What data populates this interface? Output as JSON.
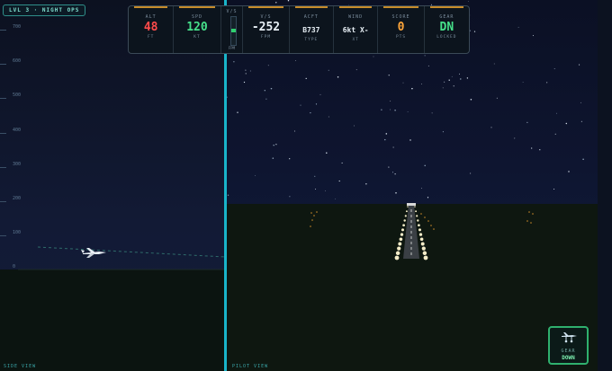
{
  "level_badge": "LVL 3 · NIGHT OPS",
  "side_view": {
    "label": "SIDE VIEW",
    "altitude_ticks": [
      "700",
      "600",
      "500",
      "400",
      "300",
      "200",
      "100",
      "0"
    ],
    "aircraft_icon": "jet-silhouette"
  },
  "pilot_view": {
    "label": "PILOT VIEW"
  },
  "hud": {
    "alt": {
      "label": "ALT",
      "value": "48",
      "unit": "FT"
    },
    "spd": {
      "label": "SPD",
      "value": "120",
      "unit": "KT"
    },
    "vs_meter": {
      "label": "V/S",
      "foot": "FPM"
    },
    "vs": {
      "label": "V/S",
      "value": "-252",
      "unit": "FPM"
    },
    "acft": {
      "label": "ACFT",
      "value": "B737",
      "unit": "TYPE"
    },
    "wind": {
      "label": "WIND",
      "value": "6kt X-",
      "unit": "XT"
    },
    "score": {
      "label": "SCORE",
      "value": "0",
      "unit": "PTS"
    },
    "gear": {
      "label": "GEAR",
      "value": "DN",
      "unit": "LOCKED"
    }
  },
  "gear_button": {
    "label": "GEAR",
    "state": "DOWN",
    "icon": "landing-gear-icon"
  },
  "colors": {
    "accent": "#19b4c9",
    "alt_red": "#ff4b4b",
    "green": "#46e08a",
    "white": "#e8f0f6",
    "orange": "#ffa63a",
    "hud_bar": "#c78b2a"
  }
}
